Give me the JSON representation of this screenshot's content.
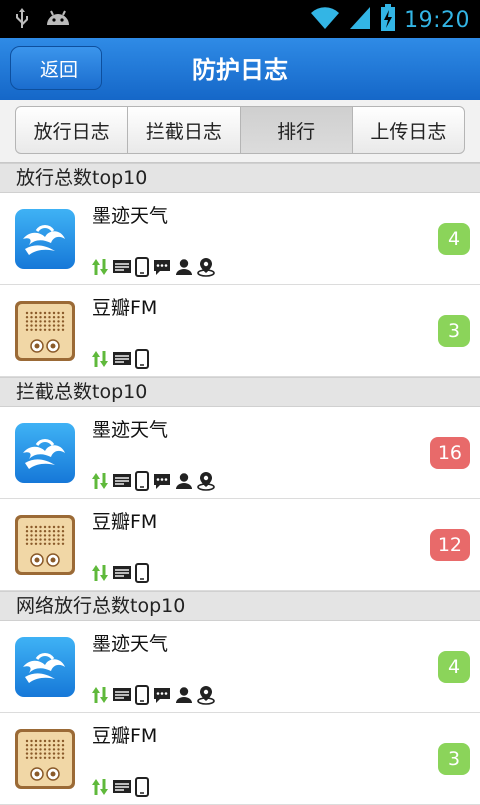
{
  "status_bar": {
    "time": "19:20",
    "icons": [
      "usb-icon",
      "android-icon",
      "wifi-icon",
      "signal-icon",
      "battery-charging-icon"
    ],
    "accent_color": "#33b5e5"
  },
  "header": {
    "back_label": "返回",
    "title": "防护日志",
    "color": "#1f78d8"
  },
  "tabs": [
    {
      "label": "放行日志",
      "active": false
    },
    {
      "label": "拦截日志",
      "active": false
    },
    {
      "label": "排行",
      "active": true
    },
    {
      "label": "上传日志",
      "active": false
    }
  ],
  "sections": [
    {
      "title": "放行总数top10",
      "items": [
        {
          "name": "墨迹天气",
          "icon": "moji-weather-icon",
          "count": "4",
          "badge_color": "#8bd45a",
          "permissions": [
            "network-icon",
            "sms-icon",
            "phone-icon",
            "message-icon",
            "contacts-icon",
            "location-icon"
          ]
        },
        {
          "name": "豆瓣FM",
          "icon": "douban-fm-icon",
          "count": "3",
          "badge_color": "#8bd45a",
          "permissions": [
            "network-icon",
            "sms-icon",
            "phone-icon"
          ]
        }
      ]
    },
    {
      "title": "拦截总数top10",
      "items": [
        {
          "name": "墨迹天气",
          "icon": "moji-weather-icon",
          "count": "16",
          "badge_color": "#e86a6a",
          "permissions": [
            "network-icon",
            "sms-icon",
            "phone-icon",
            "message-icon",
            "contacts-icon",
            "location-icon"
          ]
        },
        {
          "name": "豆瓣FM",
          "icon": "douban-fm-icon",
          "count": "12",
          "badge_color": "#e86a6a",
          "permissions": [
            "network-icon",
            "sms-icon",
            "phone-icon"
          ]
        }
      ]
    },
    {
      "title": "网络放行总数top10",
      "items": [
        {
          "name": "墨迹天气",
          "icon": "moji-weather-icon",
          "count": "4",
          "badge_color": "#8bd45a",
          "permissions": [
            "network-icon",
            "sms-icon",
            "phone-icon",
            "message-icon",
            "contacts-icon",
            "location-icon"
          ]
        },
        {
          "name": "豆瓣FM",
          "icon": "douban-fm-icon",
          "count": "3",
          "badge_color": "#8bd45a",
          "permissions": [
            "network-icon",
            "sms-icon",
            "phone-icon"
          ]
        }
      ]
    }
  ]
}
